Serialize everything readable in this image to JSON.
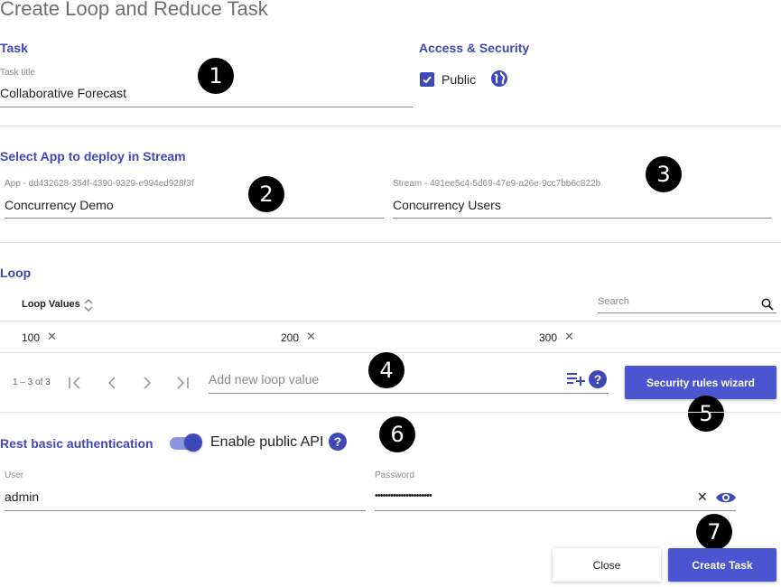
{
  "dialog": {
    "title": "Create Loop and Reduce Task"
  },
  "task": {
    "section_label": "Task",
    "title_label": "Task title",
    "title_value": "Collaborative Forecast"
  },
  "access": {
    "section_label": "Access & Security",
    "public_label": "Public",
    "public_checked": true
  },
  "app_select": {
    "section_label": "Select App to deploy in Stream",
    "app_label": "App - dd432628-354f-4390-9329-e994ed928f3f",
    "app_value": "Concurrency Demo",
    "stream_label": "Stream - 491ee5c4-5d69-47e9-a26e-9cc7bb6c822b",
    "stream_value": "Concurrency Users"
  },
  "loop": {
    "section_label": "Loop",
    "column_header": "Loop Values",
    "search_placeholder": "Search",
    "values": [
      "100",
      "200",
      "300"
    ],
    "pagination": "1 – 3 of 3",
    "add_placeholder": "Add new loop value",
    "security_button": "Security rules wizard"
  },
  "rest_auth": {
    "section_label": "Rest basic authentication",
    "toggle_label": "Enable public API",
    "toggle_on": true,
    "user_label": "User",
    "user_value": "admin",
    "password_label": "Password",
    "password_value": "••••••••••••••••••••••"
  },
  "footer": {
    "close_label": "Close",
    "create_label": "Create Task"
  },
  "badges": [
    "1",
    "2",
    "3",
    "4",
    "5",
    "6",
    "7"
  ],
  "colors": {
    "accent": "#3f48b8",
    "button": "#4a55cf",
    "toggle_track": "#8e94e0"
  }
}
